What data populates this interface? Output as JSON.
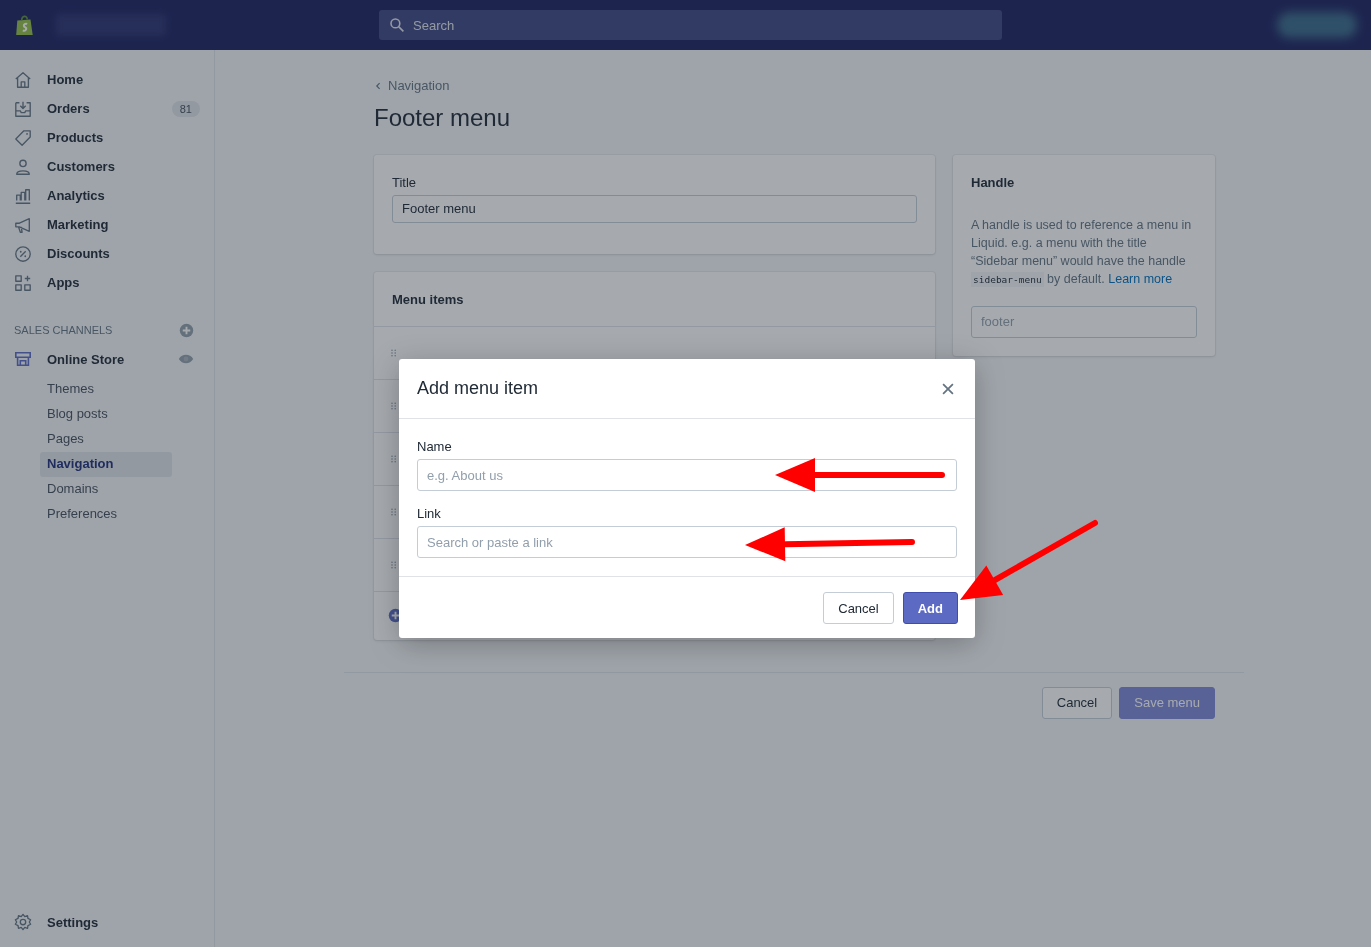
{
  "topbar": {
    "search": {
      "placeholder": "Search"
    }
  },
  "sidebar": {
    "items": [
      {
        "label": "Home",
        "kind": "home",
        "selected": false
      },
      {
        "label": "Orders",
        "kind": "orders",
        "selected": false,
        "badge": "81"
      },
      {
        "label": "Products",
        "kind": "tag",
        "selected": false
      },
      {
        "label": "Customers",
        "kind": "person",
        "selected": false
      },
      {
        "label": "Analytics",
        "kind": "chart",
        "selected": false
      },
      {
        "label": "Marketing",
        "kind": "megaphone",
        "selected": false
      },
      {
        "label": "Discounts",
        "kind": "discount",
        "selected": false
      },
      {
        "label": "Apps",
        "kind": "apps",
        "selected": false
      }
    ],
    "section": {
      "title": "SALES CHANNELS"
    },
    "channel": {
      "label": "Online Store",
      "children": [
        {
          "label": "Themes",
          "selected": false
        },
        {
          "label": "Blog posts",
          "selected": false
        },
        {
          "label": "Pages",
          "selected": false
        },
        {
          "label": "Navigation",
          "selected": true
        },
        {
          "label": "Domains",
          "selected": false
        },
        {
          "label": "Preferences",
          "selected": false
        }
      ]
    },
    "settings": {
      "label": "Settings"
    }
  },
  "page": {
    "breadcrumb": "Navigation",
    "title": "Footer menu",
    "title_card": {
      "label": "Title",
      "value": "Footer menu"
    },
    "menu_items": {
      "heading": "Menu items",
      "rows": [
        {
          "drag_handle": true
        },
        {
          "drag_handle": true
        },
        {
          "drag_handle": true
        },
        {
          "drag_handle": true
        },
        {
          "drag_handle": true
        }
      ]
    },
    "handle_card": {
      "heading": "Handle",
      "help_before": "A handle is used to reference a menu in Liquid. e.g. a menu with the title “Sidebar menu” would have the handle",
      "help_code": "sidebar-menu",
      "help_after": "by default.",
      "link": "Learn more",
      "value": "footer"
    },
    "actions": {
      "cancel": "Cancel",
      "save": {
        "label": "Save menu",
        "disabled": true
      }
    }
  },
  "modal": {
    "title": "Add menu item",
    "fields": [
      {
        "label": "Name",
        "placeholder": "e.g. About us"
      },
      {
        "label": "Link",
        "placeholder": "Search or paste a link"
      }
    ],
    "buttons": [
      {
        "label": "Cancel",
        "kind": "secondary"
      },
      {
        "label": "Add",
        "kind": "primary"
      }
    ]
  }
}
